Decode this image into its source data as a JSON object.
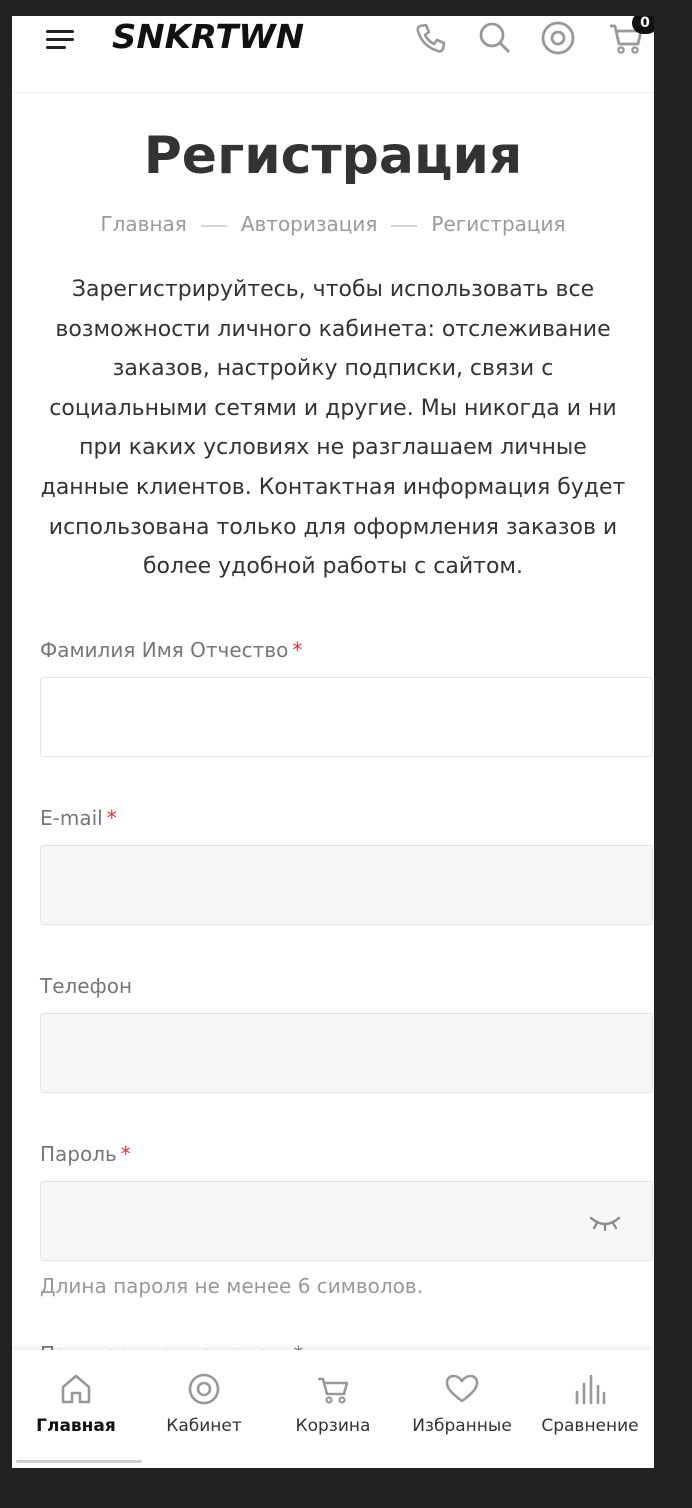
{
  "header": {
    "logo_text": "SNKRTWN",
    "cart_count": "0",
    "icons": [
      "menu-icon",
      "phone-icon",
      "search-icon",
      "account-icon",
      "cart-icon"
    ]
  },
  "page": {
    "title": "Регистрация",
    "breadcrumb": [
      "Главная",
      "Авторизация",
      "Регистрация"
    ],
    "intro": "Зарегистрируйтесь, чтобы использовать все возможности личного кабинета: отслеживание заказов, настройку подписки, связи с социальными сетями и другие. Мы никогда и ни при каких условиях не разглашаем личные данные клиентов. Контактная информация будет использована только для оформления заказов и более удобной работы с сайтом."
  },
  "form": {
    "fullname_label": "Фамилия Имя Отчество",
    "fullname_value": "",
    "email_label": "E-mail",
    "email_value": "",
    "phone_label": "Телефон",
    "phone_value": "",
    "password_label": "Пароль",
    "password_value": "",
    "password_hint": "Длина пароля не менее 6 символов.",
    "required_mark": "*",
    "next_label_partial": "Подтверждение пароля"
  },
  "bottom_nav": [
    {
      "label": "Главная",
      "icon": "home-icon",
      "active": true
    },
    {
      "label": "Кабинет",
      "icon": "account-icon"
    },
    {
      "label": "Корзина",
      "icon": "cart-icon"
    },
    {
      "label": "Избранные",
      "icon": "heart-icon"
    },
    {
      "label": "Сравнение",
      "icon": "compare-icon"
    }
  ],
  "colors": {
    "text": "#333333",
    "muted": "#9b9b9b",
    "required": "#e03131",
    "field_bg": "#f7f7f7",
    "frame": "#222222"
  }
}
